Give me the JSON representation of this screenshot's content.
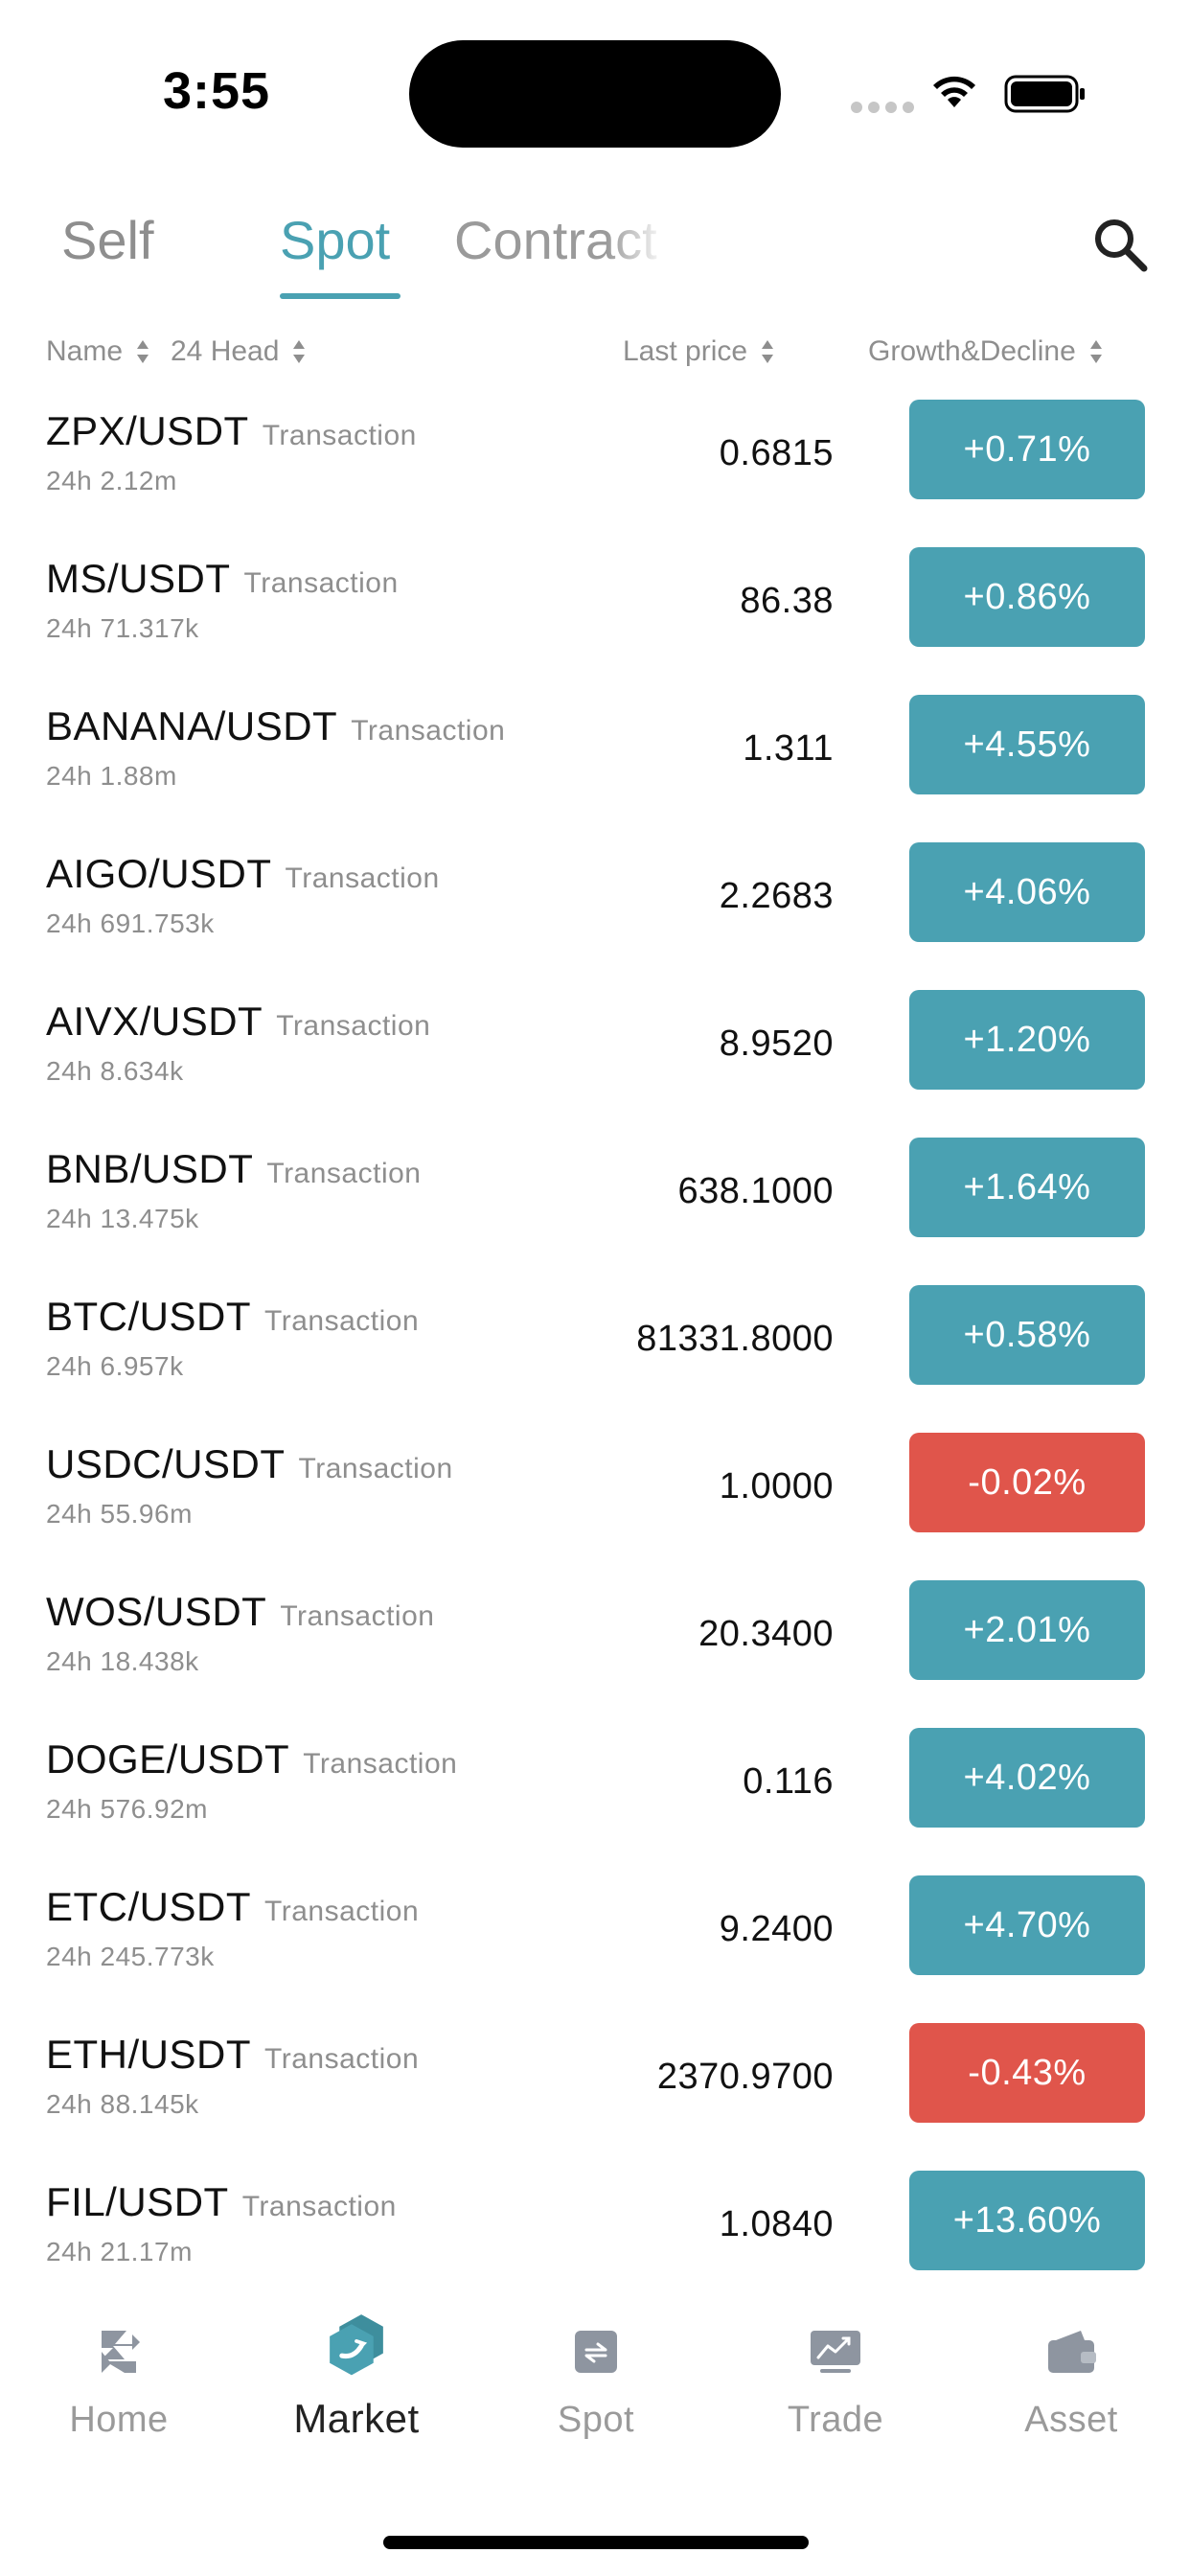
{
  "status_bar": {
    "time": "3:55"
  },
  "tabs": [
    {
      "label": "Self"
    },
    {
      "label": "Spot"
    },
    {
      "label": "Contract"
    }
  ],
  "header": {
    "name": "Name",
    "head": "24 Head",
    "price": "Last price",
    "growth": "Growth&Decline"
  },
  "colors": {
    "accent": "#4aa1b2",
    "up": "#4aa1b2",
    "down": "#e0554b"
  },
  "rows": [
    {
      "pair": "ZPX/USDT",
      "tag": "Transaction",
      "volume": "24h 2.12m",
      "price": "0.6815",
      "change": "+0.71%",
      "color": "#4aa1b2"
    },
    {
      "pair": "MS/USDT",
      "tag": "Transaction",
      "volume": "24h 71.317k",
      "price": "86.38",
      "change": "+0.86%",
      "color": "#4aa1b2"
    },
    {
      "pair": "BANANA/USDT",
      "tag": "Transaction",
      "volume": "24h 1.88m",
      "price": "1.311",
      "change": "+4.55%",
      "color": "#4aa1b2"
    },
    {
      "pair": "AIGO/USDT",
      "tag": "Transaction",
      "volume": "24h 691.753k",
      "price": "2.2683",
      "change": "+4.06%",
      "color": "#4aa1b2"
    },
    {
      "pair": "AIVX/USDT",
      "tag": "Transaction",
      "volume": "24h 8.634k",
      "price": "8.9520",
      "change": "+1.20%",
      "color": "#4aa1b2"
    },
    {
      "pair": "BNB/USDT",
      "tag": "Transaction",
      "volume": "24h 13.475k",
      "price": "638.1000",
      "change": "+1.64%",
      "color": "#4aa1b2"
    },
    {
      "pair": "BTC/USDT",
      "tag": "Transaction",
      "volume": "24h 6.957k",
      "price": "81331.8000",
      "change": "+0.58%",
      "color": "#4aa1b2"
    },
    {
      "pair": "USDC/USDT",
      "tag": "Transaction",
      "volume": "24h 55.96m",
      "price": "1.0000",
      "change": "-0.02%",
      "color": "#e0554b"
    },
    {
      "pair": "WOS/USDT",
      "tag": "Transaction",
      "volume": "24h 18.438k",
      "price": "20.3400",
      "change": "+2.01%",
      "color": "#4aa1b2"
    },
    {
      "pair": "DOGE/USDT",
      "tag": "Transaction",
      "volume": "24h 576.92m",
      "price": "0.116",
      "change": "+4.02%",
      "color": "#4aa1b2"
    },
    {
      "pair": "ETC/USDT",
      "tag": "Transaction",
      "volume": "24h 245.773k",
      "price": "9.2400",
      "change": "+4.70%",
      "color": "#4aa1b2"
    },
    {
      "pair": "ETH/USDT",
      "tag": "Transaction",
      "volume": "24h 88.145k",
      "price": "2370.9700",
      "change": "-0.43%",
      "color": "#e0554b"
    },
    {
      "pair": "FIL/USDT",
      "tag": "Transaction",
      "volume": "24h 21.17m",
      "price": "1.0840",
      "change": "+13.60%",
      "color": "#4aa1b2"
    }
  ],
  "nav": [
    {
      "label": "Home",
      "icon": "home-icon"
    },
    {
      "label": "Market",
      "icon": "market-icon"
    },
    {
      "label": "Spot",
      "icon": "spot-icon"
    },
    {
      "label": "Trade",
      "icon": "trade-icon"
    },
    {
      "label": "Asset",
      "icon": "wallet-icon"
    }
  ]
}
